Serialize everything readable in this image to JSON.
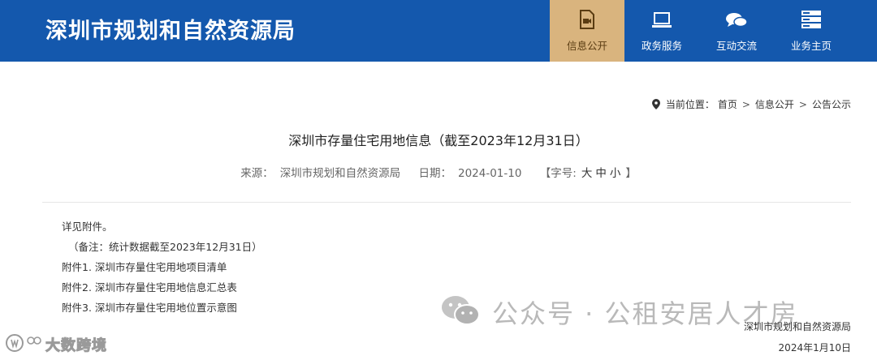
{
  "header": {
    "site_title": "深圳市规划和自然资源局",
    "nav": [
      {
        "label": "信息公开",
        "icon": "video-file-icon",
        "active": true
      },
      {
        "label": "政务服务",
        "icon": "monitor-icon",
        "active": false
      },
      {
        "label": "互动交流",
        "icon": "chat-bubbles-icon",
        "active": false
      },
      {
        "label": "业务主页",
        "icon": "server-stack-icon",
        "active": false
      }
    ]
  },
  "breadcrumb": {
    "prefix": "当前位置：",
    "items": [
      "首页",
      "信息公开",
      "公告公示"
    ],
    "separator": ">"
  },
  "article": {
    "title": "深圳市存量住宅用地信息（截至2023年12月31日）",
    "source_label": "来源：",
    "source": "深圳市规划和自然资源局",
    "date_label": "日期：",
    "date": "2024-01-10",
    "font_size_label": "【字号:",
    "font_size_options": [
      "大",
      "中",
      "小"
    ],
    "font_size_close": "】",
    "body": {
      "intro": "详见附件。",
      "note": "（备注：统计数据截至2023年12月31日）",
      "attachments": [
        "附件1. 深圳市存量住宅用地项目清单",
        "附件2. 深圳市存量住宅用地信息汇总表",
        "附件3. 深圳市存量住宅用地位置示意图"
      ]
    },
    "signoff_org": "深圳市规划和自然资源局",
    "signoff_date": "2024年1月10日"
  },
  "watermark": {
    "text": "公众号 · 公租安居人才房",
    "corner_text": "大数跨境"
  },
  "colors": {
    "header_bg": "#1458ad",
    "nav_active_bg": "#d9b47e"
  }
}
